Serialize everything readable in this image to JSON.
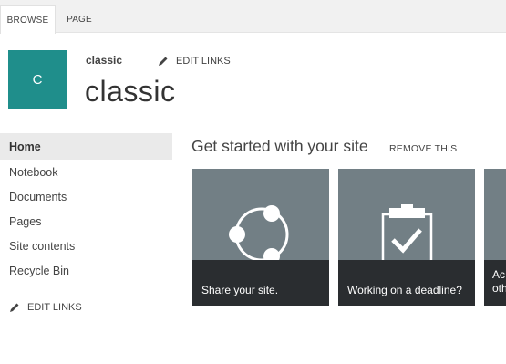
{
  "ribbon": {
    "tabs": [
      {
        "label": "BROWSE",
        "active": true
      },
      {
        "label": "PAGE",
        "active": false
      }
    ]
  },
  "header": {
    "logo_letter": "C",
    "breadcrumb": "classic",
    "edit_links": "EDIT LINKS",
    "title": "classic"
  },
  "quicklaunch": {
    "items": [
      {
        "label": "Home",
        "selected": true
      },
      {
        "label": "Notebook"
      },
      {
        "label": "Documents"
      },
      {
        "label": "Pages"
      },
      {
        "label": "Site contents"
      },
      {
        "label": "Recycle Bin"
      }
    ],
    "edit_links": "EDIT LINKS"
  },
  "get_started": {
    "title": "Get started with your site",
    "remove_label": "REMOVE THIS",
    "tiles": [
      {
        "caption": "Share your site.",
        "icon": "share-icon"
      },
      {
        "caption": "Working on a deadline?",
        "icon": "clipboard-check-icon"
      },
      {
        "caption": "Ac oth",
        "caption_lines": [
          "Ac",
          "oth"
        ],
        "icon": "partial"
      }
    ]
  },
  "colors": {
    "logo_bg": "#1f8e8b",
    "tile_bg": "#727f85",
    "tile_caption_bg": "#2a2d30",
    "ribbon_bg": "#f1f1f1"
  }
}
